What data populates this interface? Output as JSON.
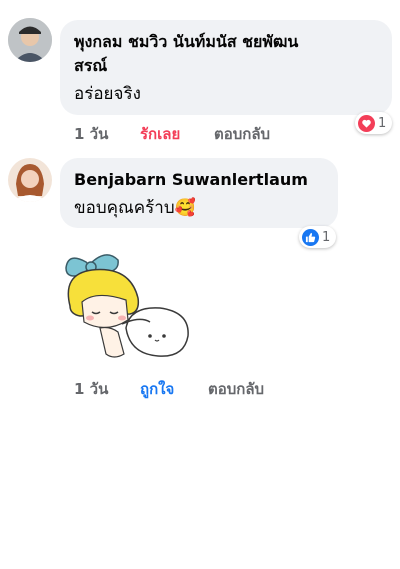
{
  "comments": [
    {
      "author": "พุงกลม ชมวิว นันท์มนัส ชยพัฒน",
      "author_cont": "สรณ์",
      "text": "อร่อยจริง",
      "time": "1 วัน",
      "reaction_label": "รักเลย",
      "reaction_color": "#f33e58",
      "reply_label": "ตอบกลับ",
      "badge_count": "1",
      "badge_icon": "heart-icon"
    },
    {
      "author": "Benjabarn Suwanlertlaum",
      "text": "ขอบคุณคร้าบ",
      "emoji": "🥰",
      "badge_count": "1",
      "badge_icon": "thumbs-up-icon"
    },
    {
      "time": "1 วัน",
      "reaction_label": "ถูกใจ",
      "reaction_color": "#1877f2",
      "reply_label": "ตอบกลับ",
      "sticker": "cartoon-girl-hugging-pillow-sticker"
    }
  ]
}
